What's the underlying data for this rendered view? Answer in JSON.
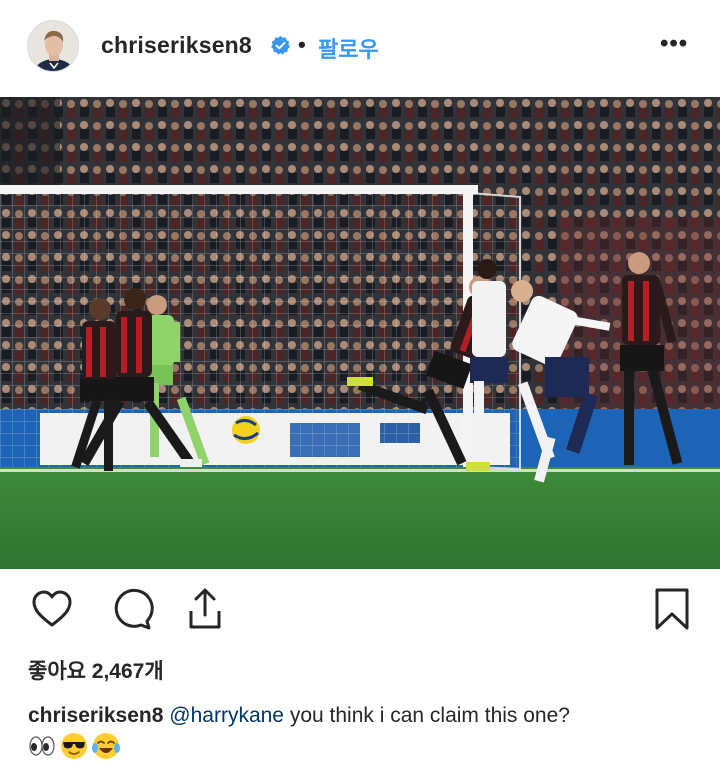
{
  "header": {
    "username": "chriseriksen8",
    "verified_icon": "verified-badge-icon",
    "separator": "•",
    "follow_label": "팔로우",
    "more_label": "•••"
  },
  "colors": {
    "follow_blue": "#3897f0",
    "verified_blue": "#3897f0",
    "text_primary": "#262626",
    "mention": "#003569"
  },
  "post": {
    "image_icon": "football-match-photo"
  },
  "actions": {
    "like_icon": "heart-icon",
    "comment_icon": "comment-bubble-icon",
    "share_icon": "share-upload-icon",
    "save_icon": "bookmark-icon"
  },
  "likes": {
    "text": "좋아요 2,467개"
  },
  "caption": {
    "username": "chriseriksen8",
    "mention": "@harrykane",
    "text": " you think i can claim this one?",
    "emojis": [
      "eyes-emoji",
      "sunglasses-face-emoji",
      "tears-of-joy-emoji"
    ]
  }
}
